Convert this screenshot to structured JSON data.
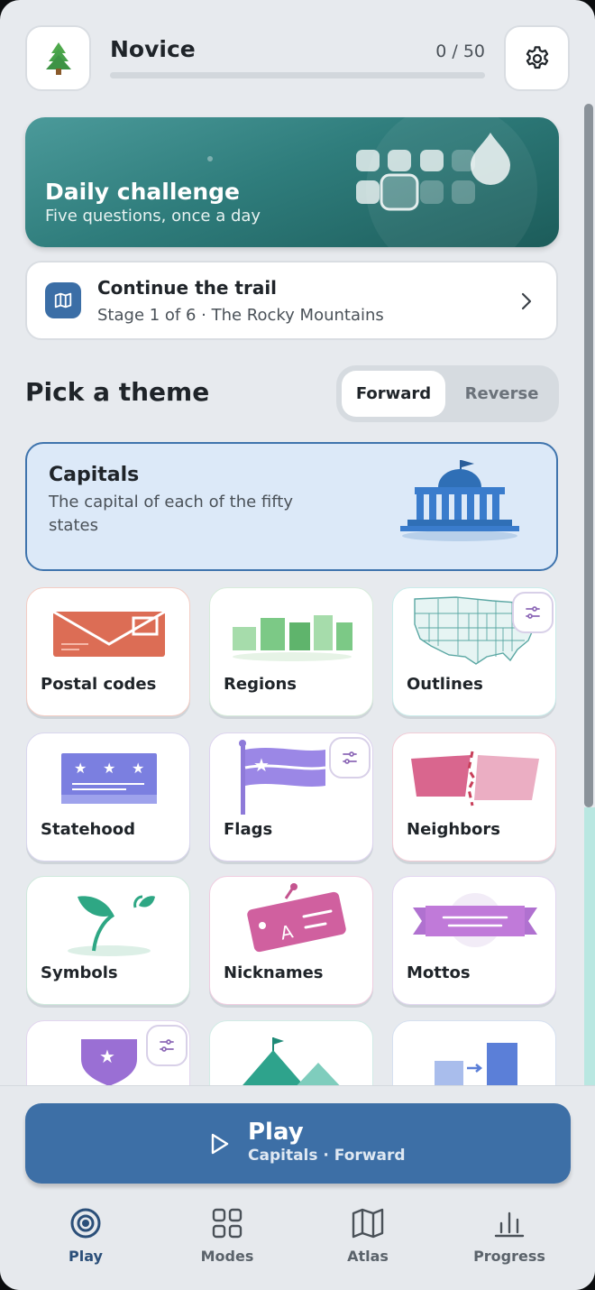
{
  "header": {
    "level_name": "Novice",
    "progress_text": "0 / 50",
    "progress_fraction": 0.0
  },
  "daily": {
    "title": "Daily challenge",
    "subtitle": "Five questions, once a day"
  },
  "continue": {
    "title": "Continue the trail",
    "subtitle": "Stage 1 of 6 · The Rocky Mountains"
  },
  "themes": {
    "section_title": "Pick a theme",
    "direction": {
      "forward": "Forward",
      "reverse": "Reverse",
      "selected": "Forward"
    },
    "featured": {
      "title": "Capitals",
      "description": "The capital of each of the fifty states"
    },
    "tiles": [
      {
        "label": "Postal codes"
      },
      {
        "label": "Regions"
      },
      {
        "label": "Outlines"
      },
      {
        "label": "Statehood"
      },
      {
        "label": "Flags"
      },
      {
        "label": "Neighbors"
      },
      {
        "label": "Symbols"
      },
      {
        "label": "Nicknames"
      },
      {
        "label": "Mottos"
      }
    ]
  },
  "play": {
    "title": "Play",
    "subtitle": "Capitals · Forward"
  },
  "nav": [
    {
      "label": "Play",
      "icon": "target-icon"
    },
    {
      "label": "Modes",
      "icon": "grid-icon"
    },
    {
      "label": "Atlas",
      "icon": "map-icon"
    },
    {
      "label": "Progress",
      "icon": "bar-chart-icon"
    }
  ],
  "colors": {
    "accent": "#3d6fa6",
    "daily_teal": "#2f7d7c",
    "featured_bg": "#dce9f8"
  }
}
